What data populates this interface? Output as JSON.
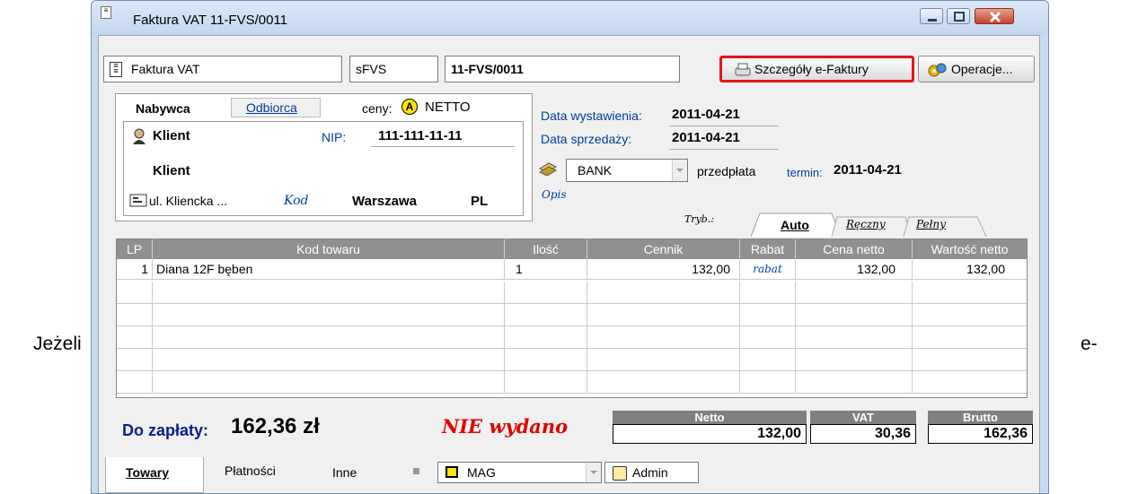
{
  "side": {
    "left_text": "Jeżeli",
    "right_text": "e-"
  },
  "window": {
    "title": "Faktura VAT 11-FVS/0011"
  },
  "toolbar": {
    "doc_type": "Faktura VAT",
    "series": "sFVS",
    "number": "11-FVS/0011",
    "efaktura_button": "Szczegóły e-Faktury",
    "operations_button": "Operacje..."
  },
  "buyer_tabs": {
    "tab1": "Nabywca",
    "tab2": "Odbiorca",
    "prices_label": "ceny:",
    "prices_badge": "A",
    "prices_value": "NETTO"
  },
  "buyer": {
    "short_name": "Klient",
    "nip_label": "NIP:",
    "nip_value": "111-111-11-11",
    "full_name": "Klient",
    "street": "ul. Kliencka ...",
    "postcode": "Kod",
    "city": "Warszawa",
    "country": "PL"
  },
  "dates": {
    "issue_label": "Data wystawienia:",
    "issue_value": "2011-04-21",
    "sale_label": "Data sprzedaży:",
    "sale_value": "2011-04-21"
  },
  "payment": {
    "method": "BANK",
    "type": "przedpłata",
    "term_label": "termin:",
    "term_value": "2011-04-21",
    "description_label": "Opis"
  },
  "mode_tabs": {
    "label": "Tryb.:",
    "auto": "Auto",
    "manual": "Ręczny",
    "full": "Pełny"
  },
  "grid": {
    "columns": [
      "LP",
      "Kod towaru",
      "Ilość",
      "Cennik",
      "Rabat",
      "Cena netto",
      "Wartość netto"
    ],
    "rows": [
      {
        "lp": "1",
        "code": "Diana 12F bęben",
        "qty": "1",
        "price_list": "132,00",
        "discount": "rabat",
        "net_price": "132,00",
        "net_value": "132,00"
      }
    ]
  },
  "summary": {
    "to_pay_label": "Do zapłaty:",
    "to_pay_value": "162,36 zł",
    "status": "NIE wydano",
    "netto_label": "Netto",
    "netto_value": "132,00",
    "vat_label": "VAT",
    "vat_value": "30,36",
    "brutto_label": "Brutto",
    "brutto_value": "162,36"
  },
  "bottom_tabs": {
    "goods": "Towary",
    "payments": "Płatności",
    "other": "Inne",
    "warehouse": "MAG",
    "user": "Admin"
  },
  "colors": {
    "highlight_red": "#e8141b",
    "total_blue": "#0a1f8f",
    "status_red": "#e00000"
  }
}
